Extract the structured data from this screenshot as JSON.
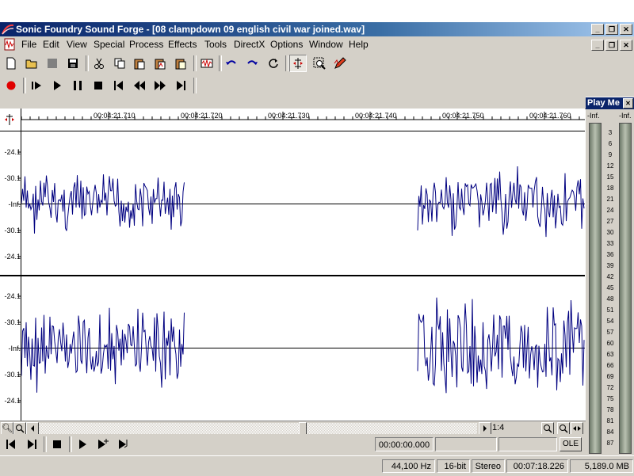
{
  "window": {
    "title": "Sonic Foundry Sound Forge - [08 clampdown 09 english civil war joined.wav]"
  },
  "menu": [
    "File",
    "Edit",
    "View",
    "Special",
    "Process",
    "Effects",
    "Tools",
    "DirectX",
    "Options",
    "Window",
    "Help"
  ],
  "ruler": {
    "labels": [
      "00:04:21.710",
      "00:04:21.720",
      "00:04:21.730",
      "00:04:21.740",
      "00:04:21.750",
      "00:04:21.760"
    ]
  },
  "channel_scale": {
    "top": [
      "-24.1",
      "-30.1",
      "-Inf.",
      "-30.1",
      "-24.1"
    ],
    "bottom": [
      "-24.1",
      "-30.1",
      "-Inf.",
      "-30.1",
      "-24.1"
    ]
  },
  "zoom": {
    "ratio": "1:4"
  },
  "transport": {
    "position": "00:00:00.000",
    "ole_label": "OLE"
  },
  "meter": {
    "title": "Play Me",
    "left_label": "-Inf.",
    "right_label": "-Inf.",
    "scale": [
      "3",
      "6",
      "9",
      "12",
      "15",
      "18",
      "21",
      "24",
      "27",
      "30",
      "33",
      "36",
      "39",
      "42",
      "45",
      "48",
      "51",
      "54",
      "57",
      "60",
      "63",
      "66",
      "69",
      "72",
      "75",
      "78",
      "81",
      "84",
      "87"
    ]
  },
  "status": {
    "sample_rate": "44,100 Hz",
    "bit_depth": "16-bit",
    "channels": "Stereo",
    "length": "00:07:18.226",
    "free_space": "5,189.0 MB"
  }
}
